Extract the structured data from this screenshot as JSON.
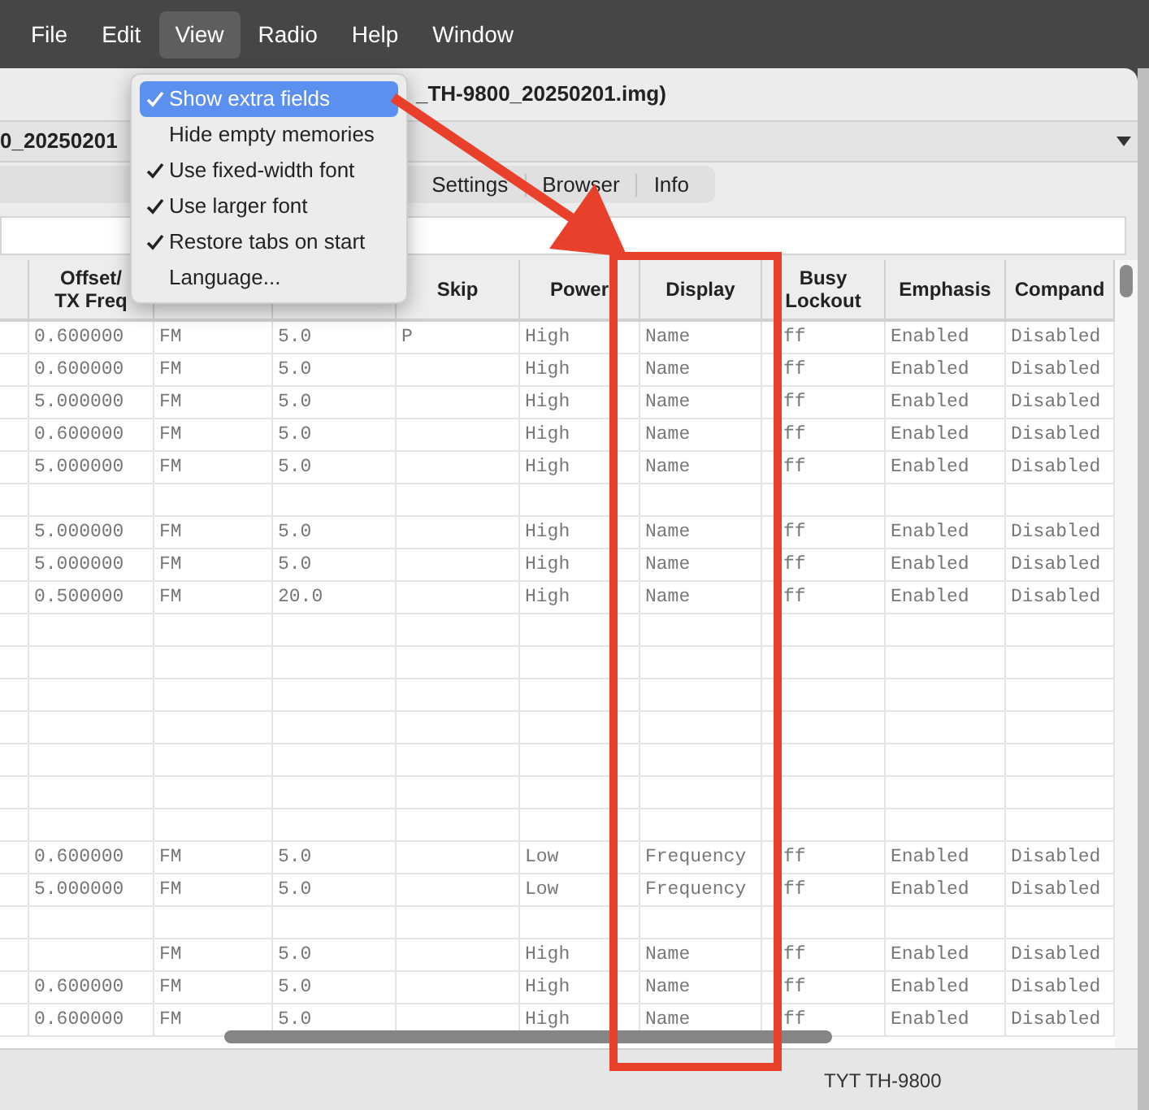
{
  "menu_bar": [
    {
      "label": "File",
      "selected": false
    },
    {
      "label": "Edit",
      "selected": false
    },
    {
      "label": "View",
      "selected": true
    },
    {
      "label": "Radio",
      "selected": false
    },
    {
      "label": "Help",
      "selected": false
    },
    {
      "label": "Window",
      "selected": false
    }
  ],
  "view_menu": [
    {
      "label": "Show extra fields",
      "checked": true,
      "selected": true
    },
    {
      "label": "Hide empty memories",
      "checked": false,
      "selected": false
    },
    {
      "label": "Use fixed-width font",
      "checked": true,
      "selected": false
    },
    {
      "label": "Use larger font",
      "checked": true,
      "selected": false
    },
    {
      "label": "Restore tabs on start",
      "checked": true,
      "selected": false
    },
    {
      "label": "Language...",
      "checked": false,
      "selected": false
    }
  ],
  "window": {
    "title": "_TH-9800_20250201.img)"
  },
  "file_tab": {
    "label": "0_20250201"
  },
  "tabs": [
    {
      "label": "Settings",
      "selected": false
    },
    {
      "label": "Browser",
      "selected": false
    },
    {
      "label": "Info",
      "selected": false
    }
  ],
  "table": {
    "columns": [
      null,
      "Offset/\nTX Freq",
      null,
      null,
      "Skip",
      "Power",
      "Display",
      "Busy\nLockout",
      "Emphasis",
      "Compand"
    ],
    "rows": [
      {
        "kind": "memory",
        "cells": [
          null,
          "0.600000",
          "FM",
          "5.0",
          "P",
          "High",
          "Name",
          "ff",
          "Enabled",
          "Disabled"
        ]
      },
      {
        "kind": "memory",
        "cells": [
          null,
          "0.600000",
          "FM",
          "5.0",
          null,
          "High",
          "Name",
          "ff",
          "Enabled",
          "Disabled"
        ]
      },
      {
        "kind": "memory",
        "cells": [
          null,
          "5.000000",
          "FM",
          "5.0",
          null,
          "High",
          "Name",
          "ff",
          "Enabled",
          "Disabled"
        ]
      },
      {
        "kind": "memory",
        "cells": [
          null,
          "0.600000",
          "FM",
          "5.0",
          null,
          "High",
          "Name",
          "ff",
          "Enabled",
          "Disabled"
        ]
      },
      {
        "kind": "memory",
        "cells": [
          null,
          "5.000000",
          "FM",
          "5.0",
          null,
          "High",
          "Name",
          "ff",
          "Enabled",
          "Disabled"
        ]
      },
      {
        "kind": "empty"
      },
      {
        "kind": "memory",
        "cells": [
          null,
          "5.000000",
          "FM",
          "5.0",
          null,
          "High",
          "Name",
          "ff",
          "Enabled",
          "Disabled"
        ]
      },
      {
        "kind": "memory",
        "cells": [
          null,
          "5.000000",
          "FM",
          "5.0",
          null,
          "High",
          "Name",
          "ff",
          "Enabled",
          "Disabled"
        ]
      },
      {
        "kind": "memory",
        "cells": [
          null,
          "0.500000",
          "FM",
          "20.0",
          null,
          "High",
          "Name",
          "ff",
          "Enabled",
          "Disabled"
        ]
      },
      {
        "kind": "empty"
      },
      {
        "kind": "empty"
      },
      {
        "kind": "empty"
      },
      {
        "kind": "empty"
      },
      {
        "kind": "empty"
      },
      {
        "kind": "empty"
      },
      {
        "kind": "empty"
      },
      {
        "kind": "memory",
        "cells": [
          null,
          "0.600000",
          "FM",
          "5.0",
          null,
          "Low",
          "Frequency",
          "ff",
          "Enabled",
          "Disabled"
        ]
      },
      {
        "kind": "memory",
        "cells": [
          null,
          "5.000000",
          "FM",
          "5.0",
          null,
          "Low",
          "Frequency",
          "ff",
          "Enabled",
          "Disabled"
        ]
      },
      {
        "kind": "empty"
      },
      {
        "kind": "memory",
        "cells": [
          null,
          null,
          "FM",
          "5.0",
          null,
          "High",
          "Name",
          "ff",
          "Enabled",
          "Disabled"
        ]
      },
      {
        "kind": "memory",
        "cells": [
          null,
          "0.600000",
          "FM",
          "5.0",
          null,
          "High",
          "Name",
          "ff",
          "Enabled",
          "Disabled"
        ]
      },
      {
        "kind": "memory",
        "cells": [
          null,
          "0.600000",
          "FM",
          "5.0",
          null,
          "High",
          "Name",
          "ff",
          "Enabled",
          "Disabled"
        ]
      }
    ]
  },
  "status_bar": {
    "text": "TYT TH-9800"
  }
}
